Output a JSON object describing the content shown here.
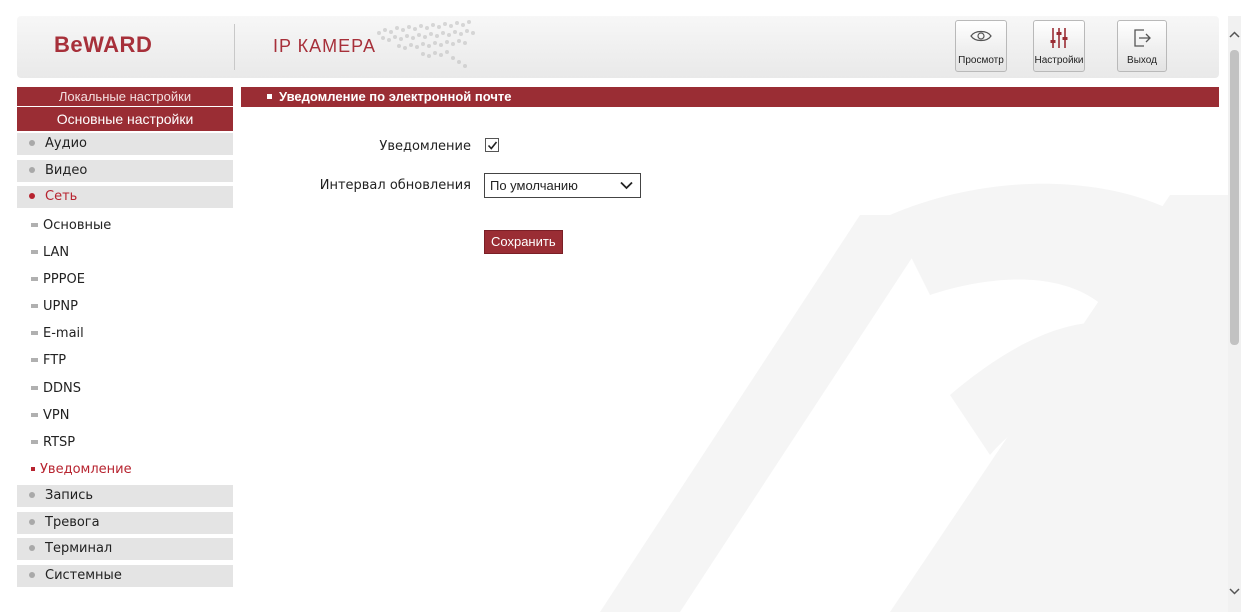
{
  "header": {
    "logo_text": "BeWARD",
    "product_title": "IP КАМЕРА",
    "buttons": {
      "view": "Просмотр",
      "settings": "Настройки",
      "exit": "Выход"
    }
  },
  "sidebar": {
    "local_settings": "Локальные настройки",
    "main_settings": "Основные настройки",
    "items_top": [
      {
        "label": "Аудио",
        "icon": "bullet-icon"
      },
      {
        "label": "Видео",
        "icon": "bullet-icon"
      },
      {
        "label": "Сеть",
        "icon": "bullet-icon",
        "active": true
      }
    ],
    "network_sub": [
      "Основные",
      "LAN",
      "PPPOE",
      "UPNP",
      "E-mail",
      "FTP",
      "DDNS",
      "VPN",
      "RTSP",
      "Уведомление"
    ],
    "active_sub": "Уведомление",
    "items_bottom": [
      {
        "label": "Запись",
        "icon": "bullet-icon"
      },
      {
        "label": "Тревога",
        "icon": "bullet-icon"
      },
      {
        "label": "Терминал",
        "icon": "bullet-icon"
      },
      {
        "label": "Системные",
        "icon": "bullet-icon"
      }
    ]
  },
  "content": {
    "section_title": "Уведомление по электронной почте",
    "notify_label": "Уведомление",
    "notify_checked": true,
    "interval_label": "Интервал обновления",
    "interval_value": "По умолчанию",
    "save_button": "Сохранить"
  },
  "colors": {
    "brand_red": "#9a2d34",
    "active_text": "#b7232f"
  }
}
